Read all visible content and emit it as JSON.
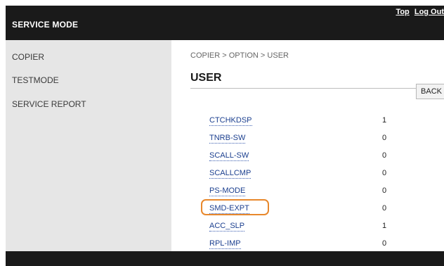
{
  "header": {
    "title": "SERVICE MODE",
    "links": [
      "Top",
      "Log Out"
    ]
  },
  "sidebar": {
    "items": [
      {
        "label": "COPIER"
      },
      {
        "label": "TESTMODE"
      },
      {
        "label": "SERVICE REPORT"
      }
    ]
  },
  "main": {
    "breadcrumb": "COPIER > OPTION > USER",
    "title": "USER",
    "back_label": "BACK",
    "settings": [
      {
        "name": "CTCHKDSP",
        "value": "1"
      },
      {
        "name": "TNRB-SW",
        "value": "0"
      },
      {
        "name": "SCALL-SW",
        "value": "0"
      },
      {
        "name": "SCALLCMP",
        "value": "0"
      },
      {
        "name": "PS-MODE",
        "value": "0"
      },
      {
        "name": "SMD-EXPT",
        "value": "0",
        "highlighted": true
      },
      {
        "name": "ACC_SLP",
        "value": "1"
      },
      {
        "name": "RPL-IMP",
        "value": "0"
      }
    ]
  },
  "colors": {
    "header_bg": "#1a1a1a",
    "sidebar_bg": "#e6e6e6",
    "link": "#1b3f8f",
    "highlight": "#e8882c"
  }
}
